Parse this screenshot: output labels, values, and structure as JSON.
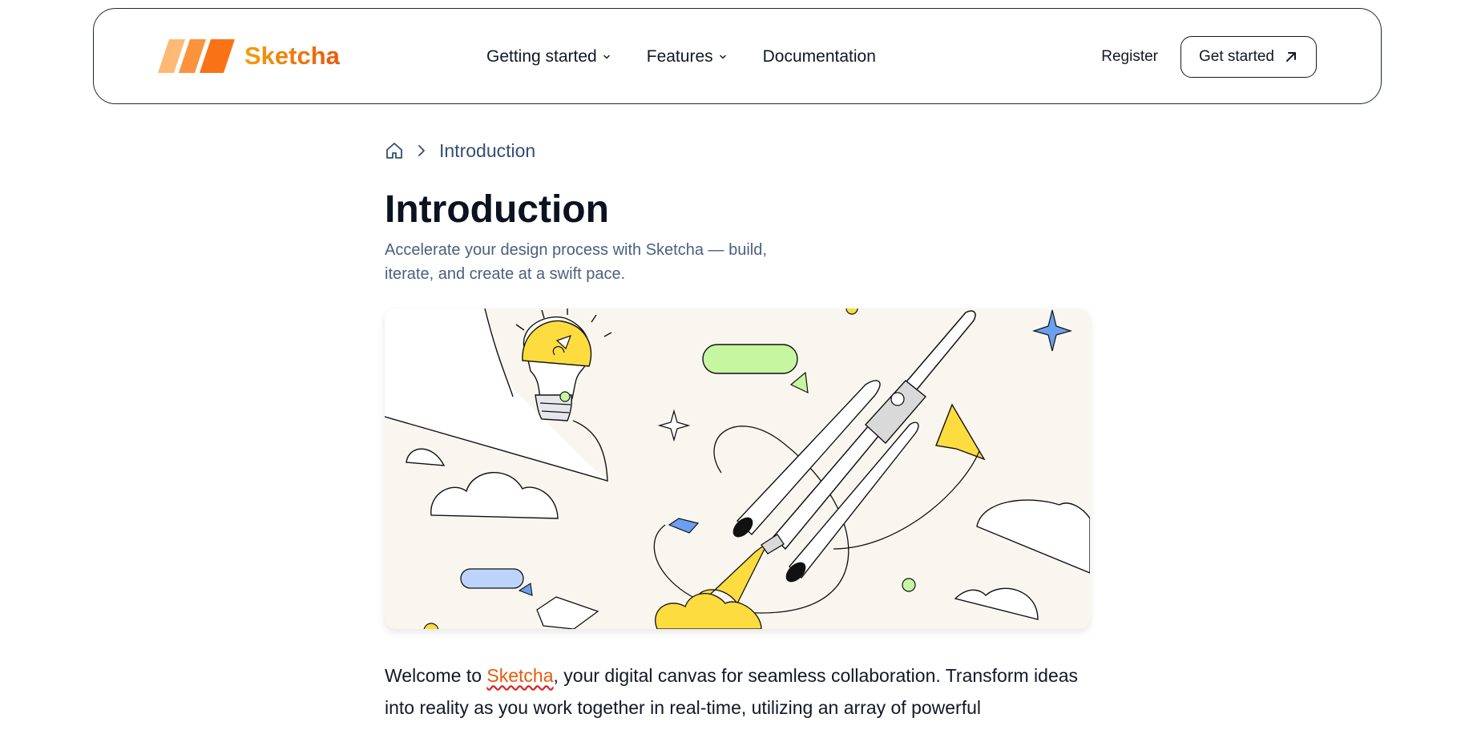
{
  "header": {
    "brand": "Sketcha",
    "nav": [
      {
        "label": "Getting started",
        "has_dropdown": true
      },
      {
        "label": "Features",
        "has_dropdown": true
      },
      {
        "label": "Documentation",
        "has_dropdown": false
      }
    ],
    "register_label": "Register",
    "cta_label": "Get started"
  },
  "breadcrumb": {
    "home_icon": "home-icon",
    "current": "Introduction"
  },
  "page": {
    "title": "Introduction",
    "subtitle": "Accelerate your design process with Sketcha — build, iterate, and create at a swift pace."
  },
  "hero": {
    "illustration": "rocket-launch-illustration"
  },
  "body": {
    "intro_before": "Welcome to ",
    "intro_brand": "Sketcha",
    "intro_after": ", your digital canvas for seamless collaboration. Transform ideas into reality as you work together in real-time, utilizing an array of powerful"
  },
  "colors": {
    "brand_orange": "#ea580c",
    "brand_amber": "#f59e0b",
    "hero_bg": "#f8f6ef",
    "yellow": "#fddc3f",
    "green": "#c6f6a0",
    "blue": "#6b9ff0"
  }
}
